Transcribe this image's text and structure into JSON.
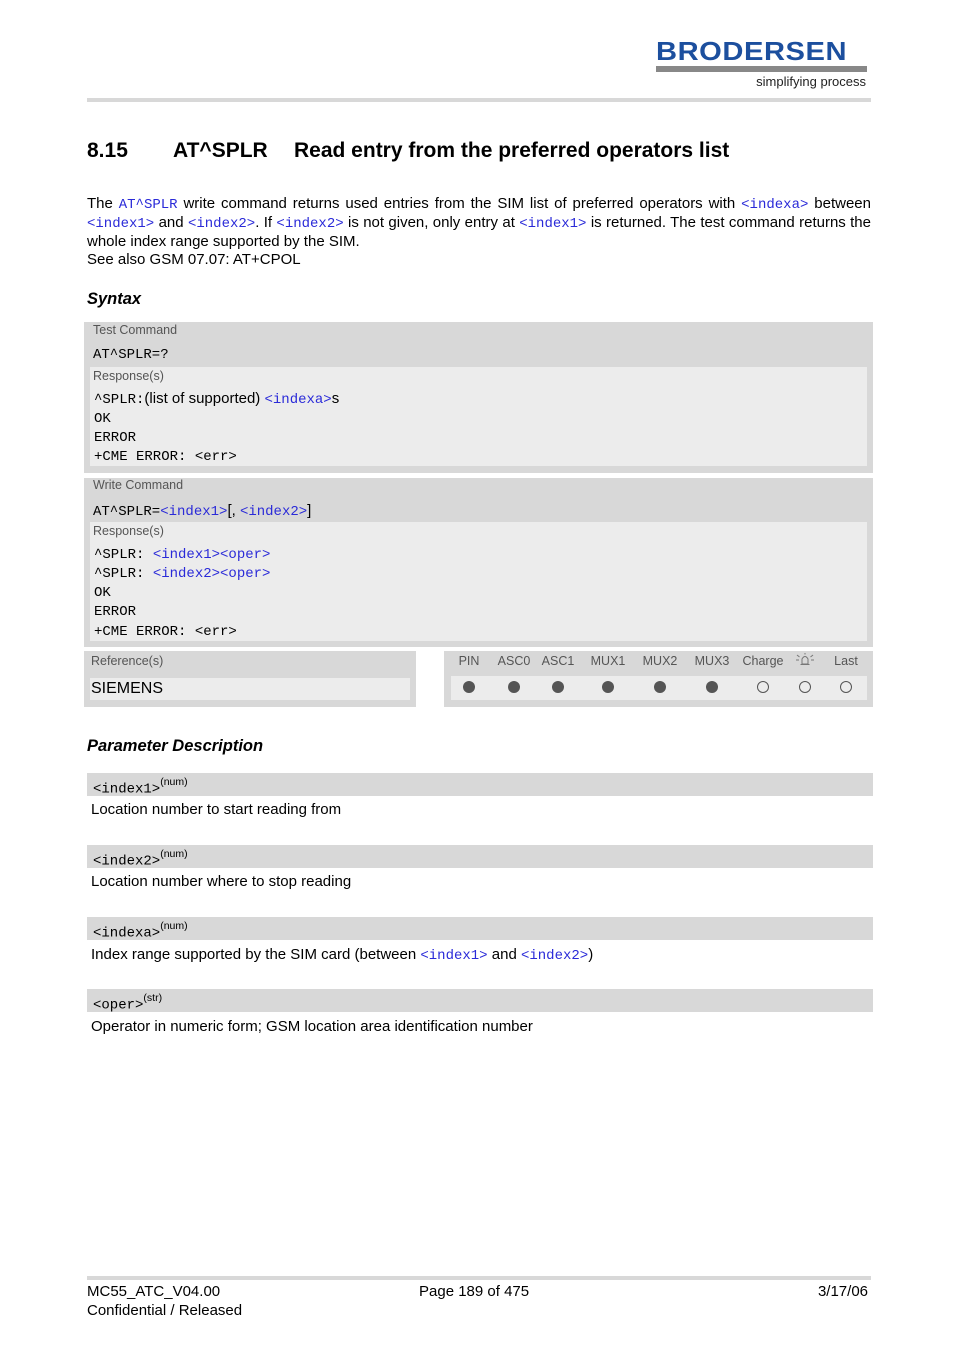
{
  "header": {
    "logo_text": "BRODERSEN",
    "logo_tagline": "simplifying process",
    "brand_color": "#1c4f9e"
  },
  "title": {
    "number": "8.15",
    "command": "AT^SPLR",
    "text": "Read entry from the preferred operators list"
  },
  "intro": {
    "p1": {
      "t1": "The ",
      "cmd": "AT^SPLR",
      "t2": " write command returns used entries from the SIM list of preferred operators with ",
      "p_indexa": "<indexa>",
      "t3": " between ",
      "p_index1": "<index1>",
      "t4": " and ",
      "p_index2": "<index2>",
      "t5": ". If ",
      "p_index2b": "<index2>",
      "t6": " is not given, only entry at ",
      "p_index1b": "<index1>",
      "t7": " is returned. The test command returns the whole index range supported by the SIM."
    },
    "p2": "See also GSM 07.07: AT+CPOL"
  },
  "syntax": {
    "heading": "Syntax",
    "test": {
      "label": "Test Command",
      "command": "AT^SPLR=?",
      "response_label": "Response(s)",
      "lines": {
        "r1_prefix": "^SPLR:",
        "r1_text": "(list of supported) ",
        "r1_param": "<indexa>",
        "r1_suffix": "s",
        "ok": "OK",
        "error": "ERROR",
        "cme": "+CME ERROR: <err>"
      }
    },
    "write": {
      "label": "Write Command",
      "cmd_prefix": "AT^SPLR=",
      "cmd_p1": "<index1>",
      "cmd_mid": "[, ",
      "cmd_p2": "<index2>",
      "cmd_end": "]",
      "response_label": "Response(s)",
      "lines": {
        "r1_prefix": "^SPLR: ",
        "r1_param": "<index1><oper>",
        "r2_prefix": "^SPLR: ",
        "r2_param": "<index2><oper>",
        "ok": "OK",
        "error": "ERROR",
        "cme": "+CME ERROR: <err>"
      }
    },
    "reference": {
      "label": "Reference(s)",
      "value": "SIEMENS"
    },
    "flags": [
      {
        "label": "PIN",
        "on": true
      },
      {
        "label": "ASC0",
        "on": true
      },
      {
        "label": "ASC1",
        "on": true
      },
      {
        "label": "MUX1",
        "on": true
      },
      {
        "label": "MUX2",
        "on": true
      },
      {
        "label": "MUX3",
        "on": true
      },
      {
        "label": "Charge",
        "on": false
      },
      {
        "label": "alarm-icon",
        "on": false
      },
      {
        "label": "Last",
        "on": false
      }
    ]
  },
  "parameters": {
    "heading": "Parameter Description",
    "items": [
      {
        "name": "<index1>",
        "type": "(num)",
        "desc": "Location number to start reading from"
      },
      {
        "name": "<index2>",
        "type": "(num)",
        "desc": "Location number where to stop reading"
      },
      {
        "name": "<indexa>",
        "type": "(num)",
        "desc_t1": "Index range supported by the SIM card (between ",
        "desc_p1": "<index1>",
        "desc_t2": " and ",
        "desc_p2": "<index2>",
        "desc_t3": ")"
      },
      {
        "name": "<oper>",
        "type": "(str)",
        "desc": "Operator in numeric form; GSM location area identification number"
      }
    ]
  },
  "footer": {
    "doc_id": "MC55_ATC_V04.00",
    "status": "Confidential / Released",
    "page": "Page 189 of 475",
    "date": "3/17/06"
  }
}
